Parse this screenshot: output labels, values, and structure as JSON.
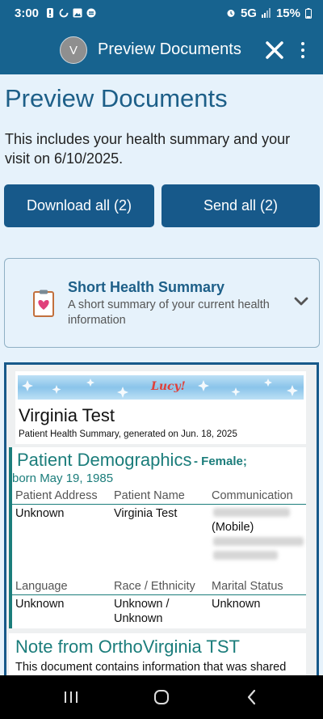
{
  "status": {
    "time": "3:00",
    "network": "5G",
    "battery": "15%"
  },
  "appbar": {
    "avatar_initial": "V",
    "title": "Preview Documents"
  },
  "page": {
    "title": "Preview Documents",
    "intro": "This includes your health summary and your visit on 6/10/2025.",
    "download_all": "Download all (2)",
    "send_all": "Send all (2)"
  },
  "document": {
    "name": "Short Health Summary",
    "description": "A short summary of your current health information"
  },
  "preview": {
    "logo_text": "Lucy!",
    "patient_name": "Virginia Test",
    "generated": "Patient Health Summary, generated on Jun. 18, 2025",
    "demographics": {
      "title": "Patient Demographics",
      "subtitle": "- Female;",
      "born": "born May 19, 1985",
      "headers": [
        "Patient Address",
        "Patient Name",
        "Communication"
      ],
      "values": [
        "Unknown",
        "Virginia Test",
        "(Mobile)"
      ],
      "headers2": [
        "Language",
        "Race / Ethnicity",
        "Marital Status"
      ],
      "values2": [
        "Unknown",
        "Unknown /",
        "Unknown"
      ],
      "values2b": "Unknown"
    },
    "note": {
      "title": "Note from OrthoVirginia TST",
      "text": "This document contains information that was shared"
    }
  },
  "colors": {
    "brand": "#17638f",
    "button": "#17598a",
    "teal": "#1b7d7b",
    "background": "#e6f2fb"
  }
}
